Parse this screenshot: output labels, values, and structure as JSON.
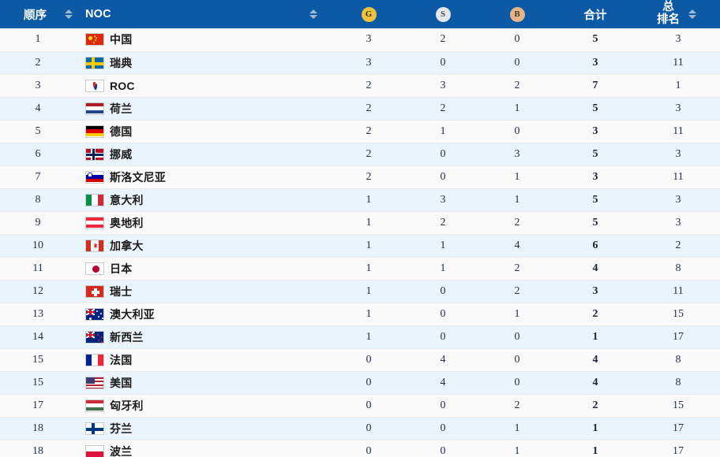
{
  "table": {
    "columns": [
      {
        "key": "rank",
        "label": "顺序",
        "sortable": true,
        "icon": "sort-icon"
      },
      {
        "key": "noc",
        "label": "NOC",
        "sortable": true,
        "icon": "sort-icon"
      },
      {
        "key": "gold",
        "label": "G",
        "badge": "gold",
        "badge_color": "#f0c33c"
      },
      {
        "key": "silver",
        "label": "S",
        "badge": "silver",
        "badge_color": "#e6e9ec"
      },
      {
        "key": "bronze",
        "label": "B",
        "badge": "bronze",
        "badge_color": "#e8b58b"
      },
      {
        "key": "total",
        "label": "合计",
        "sortable": false
      },
      {
        "key": "overall",
        "label_line1": "总",
        "label_line2": "排名",
        "sortable": true,
        "icon": "sort-icon"
      }
    ],
    "header_bg": "#0c5aa6",
    "row_bg_odd": "#fafafa",
    "row_bg_even": "#eaf4fc",
    "rows": [
      {
        "rank": "1",
        "noc": "中国",
        "flag": "cn",
        "gold": "3",
        "silver": "2",
        "bronze": "0",
        "total": "5",
        "overall": "3"
      },
      {
        "rank": "2",
        "noc": "瑞典",
        "flag": "se",
        "gold": "3",
        "silver": "0",
        "bronze": "0",
        "total": "3",
        "overall": "11"
      },
      {
        "rank": "3",
        "noc": "ROC",
        "flag": "roc",
        "gold": "2",
        "silver": "3",
        "bronze": "2",
        "total": "7",
        "overall": "1"
      },
      {
        "rank": "4",
        "noc": "荷兰",
        "flag": "nl",
        "gold": "2",
        "silver": "2",
        "bronze": "1",
        "total": "5",
        "overall": "3"
      },
      {
        "rank": "5",
        "noc": "德国",
        "flag": "de",
        "gold": "2",
        "silver": "1",
        "bronze": "0",
        "total": "3",
        "overall": "11"
      },
      {
        "rank": "6",
        "noc": "挪威",
        "flag": "no",
        "gold": "2",
        "silver": "0",
        "bronze": "3",
        "total": "5",
        "overall": "3"
      },
      {
        "rank": "7",
        "noc": "斯洛文尼亚",
        "flag": "si",
        "gold": "2",
        "silver": "0",
        "bronze": "1",
        "total": "3",
        "overall": "11"
      },
      {
        "rank": "8",
        "noc": "意大利",
        "flag": "it",
        "gold": "1",
        "silver": "3",
        "bronze": "1",
        "total": "5",
        "overall": "3"
      },
      {
        "rank": "9",
        "noc": "奥地利",
        "flag": "at",
        "gold": "1",
        "silver": "2",
        "bronze": "2",
        "total": "5",
        "overall": "3"
      },
      {
        "rank": "10",
        "noc": "加拿大",
        "flag": "ca",
        "gold": "1",
        "silver": "1",
        "bronze": "4",
        "total": "6",
        "overall": "2"
      },
      {
        "rank": "11",
        "noc": "日本",
        "flag": "jp",
        "gold": "1",
        "silver": "1",
        "bronze": "2",
        "total": "4",
        "overall": "8"
      },
      {
        "rank": "12",
        "noc": "瑞士",
        "flag": "ch",
        "gold": "1",
        "silver": "0",
        "bronze": "2",
        "total": "3",
        "overall": "11"
      },
      {
        "rank": "13",
        "noc": "澳大利亚",
        "flag": "au",
        "gold": "1",
        "silver": "0",
        "bronze": "1",
        "total": "2",
        "overall": "15"
      },
      {
        "rank": "14",
        "noc": "新西兰",
        "flag": "nz",
        "gold": "1",
        "silver": "0",
        "bronze": "0",
        "total": "1",
        "overall": "17"
      },
      {
        "rank": "15",
        "noc": "法国",
        "flag": "fr",
        "gold": "0",
        "silver": "4",
        "bronze": "0",
        "total": "4",
        "overall": "8"
      },
      {
        "rank": "15",
        "noc": "美国",
        "flag": "us",
        "gold": "0",
        "silver": "4",
        "bronze": "0",
        "total": "4",
        "overall": "8"
      },
      {
        "rank": "17",
        "noc": "匈牙利",
        "flag": "hu",
        "gold": "0",
        "silver": "0",
        "bronze": "2",
        "total": "2",
        "overall": "15"
      },
      {
        "rank": "18",
        "noc": "芬兰",
        "flag": "fi",
        "gold": "0",
        "silver": "0",
        "bronze": "1",
        "total": "1",
        "overall": "17"
      },
      {
        "rank": "18",
        "noc": "波兰",
        "flag": "pl",
        "gold": "0",
        "silver": "0",
        "bronze": "1",
        "total": "1",
        "overall": "17"
      }
    ]
  }
}
